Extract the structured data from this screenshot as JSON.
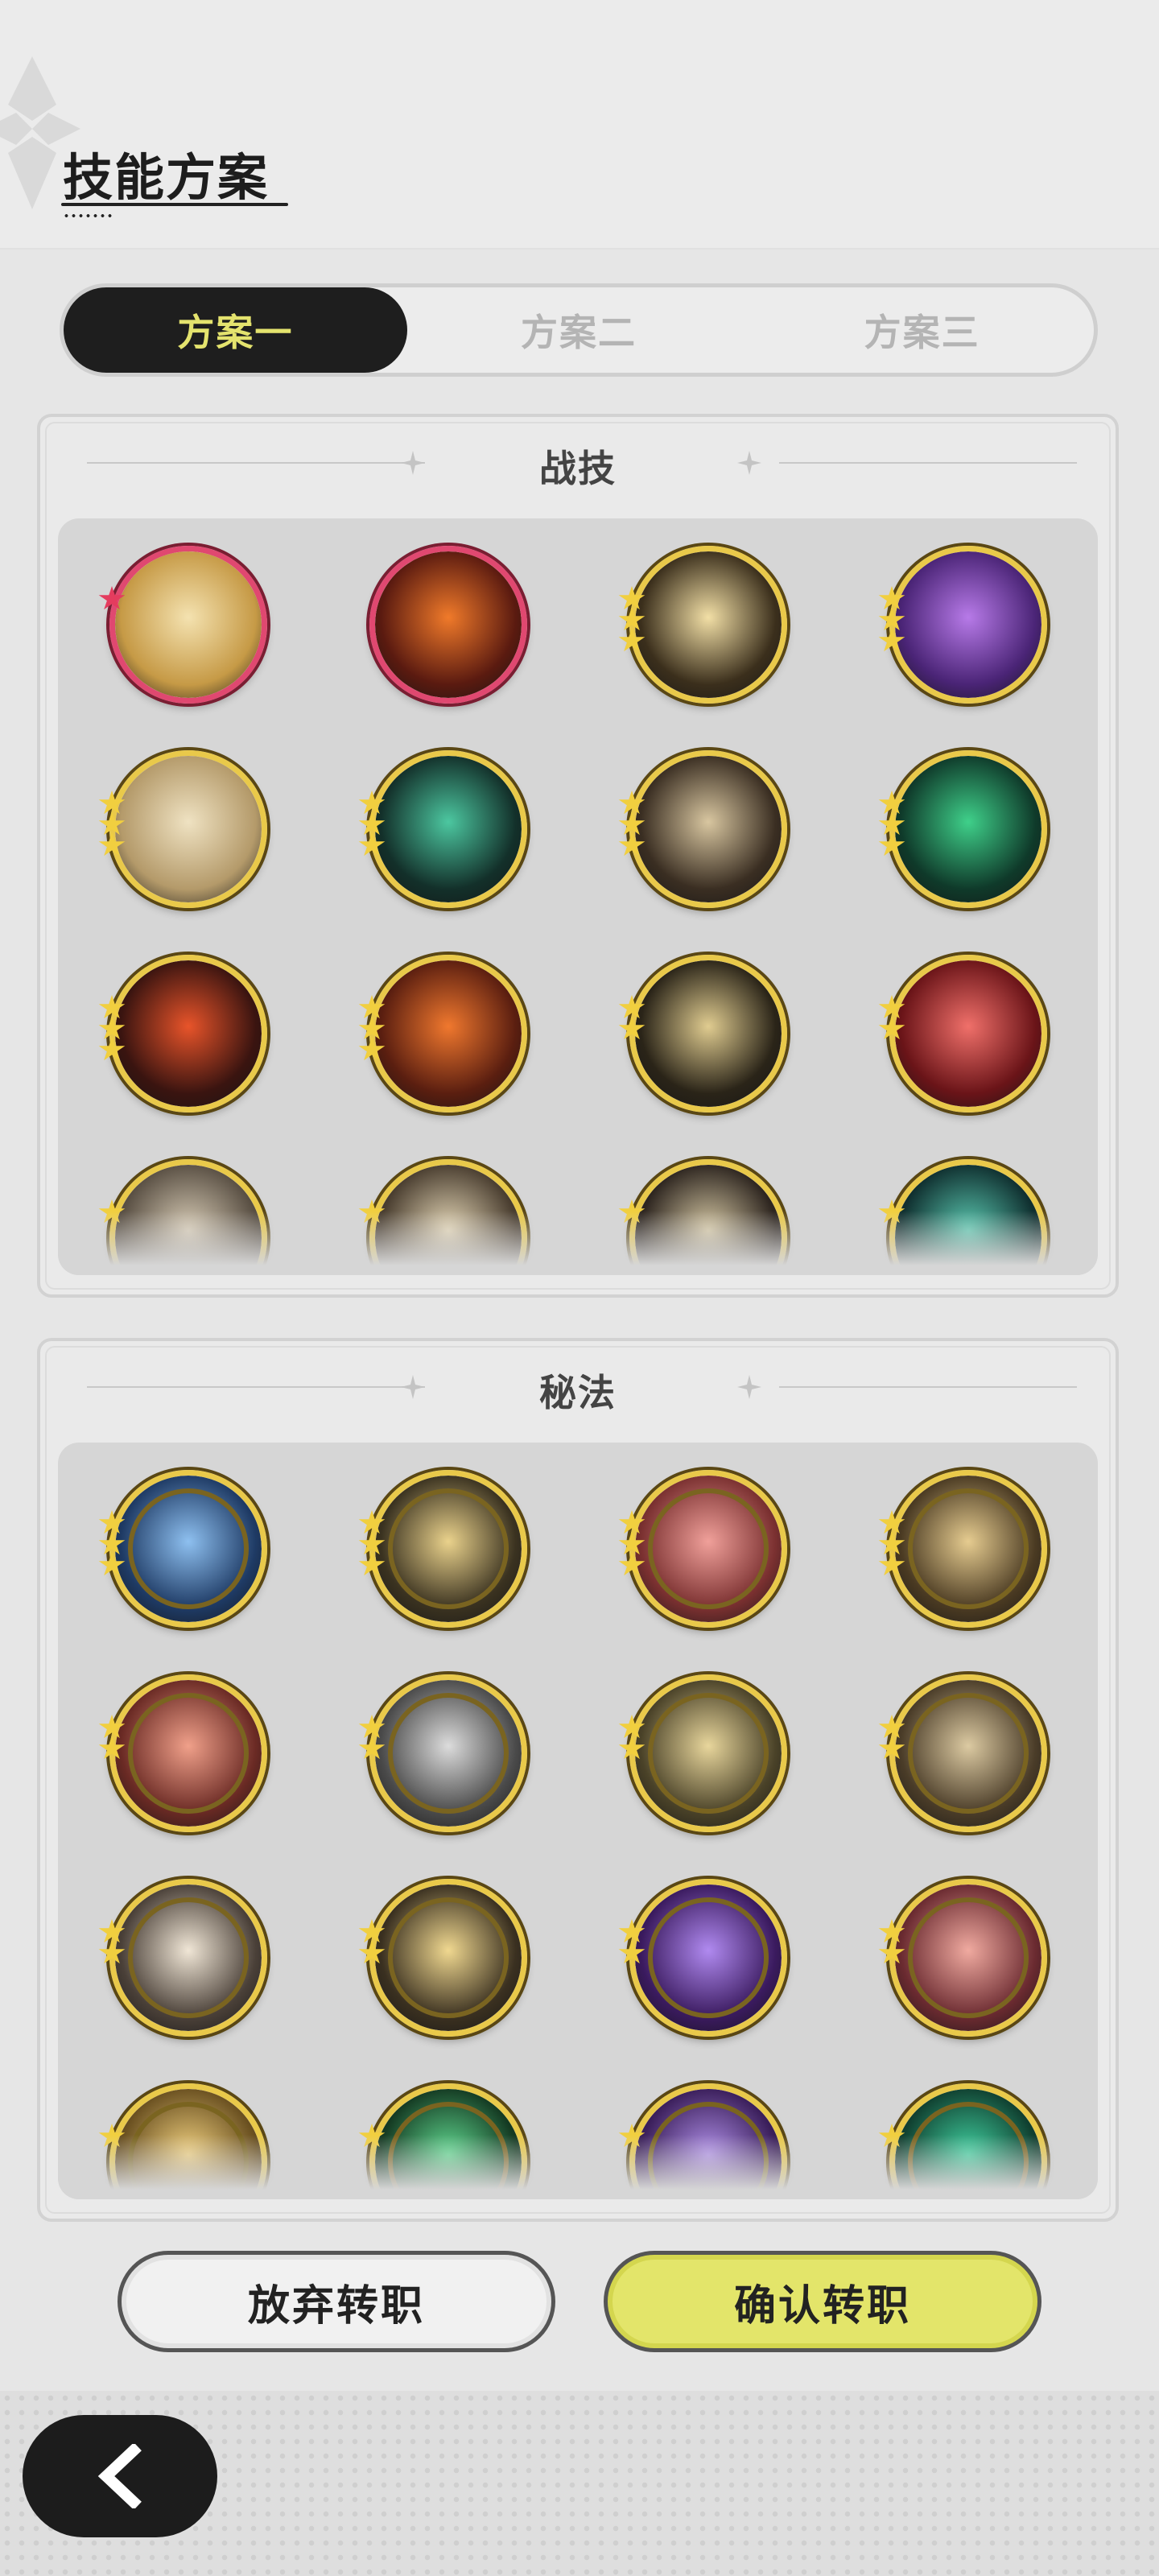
{
  "header": {
    "title": "技能方案"
  },
  "tabs": [
    {
      "label": "方案一",
      "active": true
    },
    {
      "label": "方案二",
      "active": false
    },
    {
      "label": "方案三",
      "active": false
    }
  ],
  "combat": {
    "title": "战技",
    "skills": [
      {
        "icon": "golden-swirl-icon",
        "stars": 1,
        "star_color": "red",
        "ring": "red",
        "bg": "#c69a46",
        "fg": "#f4e2b0"
      },
      {
        "icon": "fire-swirl-icon",
        "stars": 0,
        "ring": "red",
        "bg": "#5a1a10",
        "fg": "#f07a2a"
      },
      {
        "icon": "burst-icon",
        "stars": 3,
        "ring": "gold",
        "bg": "#3b2f1c",
        "fg": "#f2dfa6"
      },
      {
        "icon": "purple-roses-icon",
        "stars": 3,
        "ring": "gold",
        "bg": "#4a2476",
        "fg": "#b77ae8"
      },
      {
        "icon": "wind-slash-icon",
        "stars": 3,
        "ring": "gold",
        "bg": "#b49a6a",
        "fg": "#efe2c2"
      },
      {
        "icon": "green-wave-icon",
        "stars": 3,
        "ring": "gold",
        "bg": "#13302a",
        "fg": "#4cc7a0"
      },
      {
        "icon": "claw-strike-icon",
        "stars": 3,
        "ring": "gold",
        "bg": "#3a2e22",
        "fg": "#d8c6a0"
      },
      {
        "icon": "green-ring-icon",
        "stars": 3,
        "ring": "gold",
        "bg": "#0f3a2a",
        "fg": "#3fd08a"
      },
      {
        "icon": "red-slash-icon",
        "stars": 3,
        "ring": "gold",
        "bg": "#3a1410",
        "fg": "#e8542a"
      },
      {
        "icon": "flame-figure-icon",
        "stars": 3,
        "ring": "gold",
        "bg": "#5a1e10",
        "fg": "#f0782e"
      },
      {
        "icon": "lightning-blade-icon",
        "stars": 2,
        "ring": "gold",
        "bg": "#2a2418",
        "fg": "#e0cc90"
      },
      {
        "icon": "sword-raise-icon",
        "stars": 2,
        "ring": "gold",
        "bg": "#6a1418",
        "fg": "#f0706a"
      },
      {
        "icon": "cloud-icon",
        "stars": 1,
        "ring": "gold",
        "bg": "#5a5044",
        "fg": "#d8ccb6"
      },
      {
        "icon": "crescent-icon",
        "stars": 1,
        "ring": "gold",
        "bg": "#4a3e30",
        "fg": "#e4d6b6"
      },
      {
        "icon": "shadow-figure-icon",
        "stars": 1,
        "ring": "gold",
        "bg": "#2e2620",
        "fg": "#d6c8a4"
      },
      {
        "icon": "web-icon",
        "stars": 1,
        "ring": "gold",
        "bg": "#103030",
        "fg": "#5ac8b0"
      }
    ]
  },
  "secret": {
    "title": "秘法",
    "skills": [
      {
        "icon": "blue-emblem-icon",
        "stars": 3,
        "ring": "gold",
        "bg": "#1e3a64",
        "fg": "#8ec0f0"
      },
      {
        "icon": "eye-icon",
        "stars": 3,
        "ring": "gold",
        "bg": "#3a3220",
        "fg": "#ead28c"
      },
      {
        "icon": "pink-flower-icon",
        "stars": 3,
        "ring": "gold",
        "bg": "#7a3030",
        "fg": "#f0a09a"
      },
      {
        "icon": "golden-figure-icon",
        "stars": 3,
        "ring": "gold",
        "bg": "#4a3a22",
        "fg": "#e6cc90"
      },
      {
        "icon": "red-claw-icon",
        "stars": 2,
        "ring": "gold",
        "bg": "#6a2a24",
        "fg": "#f0a08a"
      },
      {
        "icon": "shield-figure-icon",
        "stars": 2,
        "ring": "gold",
        "bg": "#4a4a4a",
        "fg": "#dcdcdc"
      },
      {
        "icon": "golem-icon",
        "stars": 2,
        "ring": "gold",
        "bg": "#4a4228",
        "fg": "#e8d69c"
      },
      {
        "icon": "dragon-icon",
        "stars": 2,
        "ring": "gold",
        "bg": "#4a3c28",
        "fg": "#dccaa2"
      },
      {
        "icon": "sword-icon",
        "stars": 2,
        "ring": "gold",
        "bg": "#4a4038",
        "fg": "#f0e6d6"
      },
      {
        "icon": "golden-vortex-icon",
        "stars": 2,
        "ring": "gold",
        "bg": "#3a3020",
        "fg": "#f0d890"
      },
      {
        "icon": "purple-flame-icon",
        "stars": 2,
        "ring": "gold",
        "bg": "#3a1a5e",
        "fg": "#b08af0"
      },
      {
        "icon": "pink-wave-icon",
        "stars": 2,
        "ring": "gold",
        "bg": "#6a2a30",
        "fg": "#f0aaa0"
      },
      {
        "icon": "golden-beast-icon",
        "stars": 1,
        "ring": "gold",
        "bg": "#6a5020",
        "fg": "#f0d080"
      },
      {
        "icon": "green-heart-icon",
        "stars": 1,
        "ring": "gold",
        "bg": "#143a22",
        "fg": "#60d890"
      },
      {
        "icon": "purple-orb-icon",
        "stars": 1,
        "ring": "gold",
        "bg": "#3a1e5a",
        "fg": "#b090e8"
      },
      {
        "icon": "green-blade-icon",
        "stars": 1,
        "ring": "gold",
        "bg": "#104030",
        "fg": "#40d0a0"
      }
    ]
  },
  "buttons": {
    "give_up": "放弃转职",
    "confirm": "确认转职"
  },
  "colors": {
    "accent": "#e3e56a",
    "dark": "#1e1e1e",
    "gold_ring": "#e9c94a",
    "red_ring": "#e04870"
  }
}
